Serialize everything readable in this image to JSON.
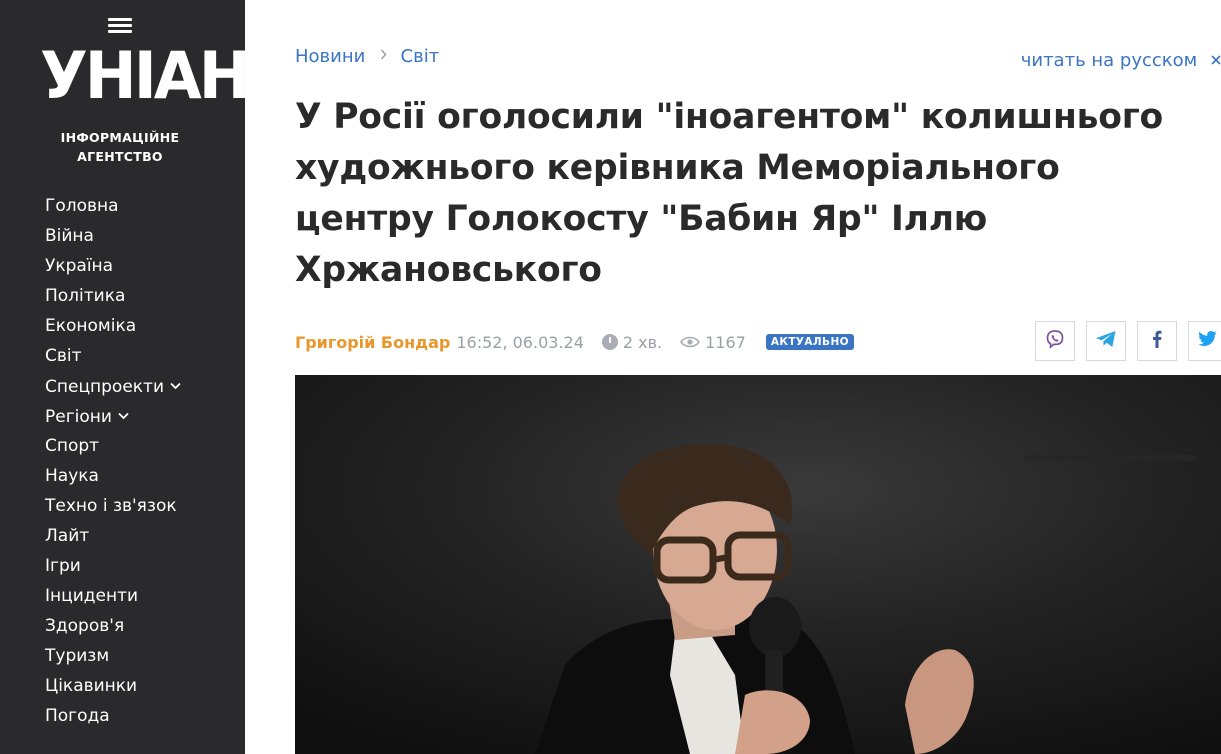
{
  "logo": {
    "name": "УНІАН",
    "subtitle_line1": "ІНФОРМАЦІЙНЕ",
    "subtitle_line2": "АГЕНТСТВО"
  },
  "nav": {
    "items": [
      {
        "label": "Головна"
      },
      {
        "label": "Війна"
      },
      {
        "label": "Україна"
      },
      {
        "label": "Політика"
      },
      {
        "label": "Економіка"
      },
      {
        "label": "Світ"
      },
      {
        "label": "Спецпроекти",
        "dropdown": true
      },
      {
        "label": "Регіони",
        "dropdown": true
      },
      {
        "label": "Спорт"
      },
      {
        "label": "Наука"
      },
      {
        "label": "Техно і зв'язок"
      },
      {
        "label": "Лайт"
      },
      {
        "label": "Ігри"
      },
      {
        "label": "Інциденти"
      },
      {
        "label": "Здоров'я"
      },
      {
        "label": "Туризм"
      },
      {
        "label": "Цікавинки"
      },
      {
        "label": "Погода"
      }
    ]
  },
  "breadcrumb": {
    "items": [
      "Новини",
      "Світ"
    ]
  },
  "lang_link": "читать на русском",
  "article": {
    "title": "У Росії оголосили \"іноагентом\" колишнього художнього керівника Меморіального центру Голокосту \"Бабин Яр\" Іллю Хржановського",
    "author": "Григорій Бондар",
    "datetime": "16:52, 06.03.24",
    "read_time": "2 хв.",
    "views": "1167",
    "badge": "АКТУАЛЬНО"
  },
  "share": {
    "buttons": [
      {
        "icon": "viber-icon",
        "color": "#7b519d"
      },
      {
        "icon": "telegram-icon",
        "color": "#2ca5e0"
      },
      {
        "icon": "facebook-icon",
        "color": "#3b5998"
      },
      {
        "icon": "twitter-icon",
        "color": "#1da1f2"
      }
    ]
  },
  "colors": {
    "sidebar_bg": "#2a2a2d",
    "link": "#3a75c4",
    "author": "#e9962b",
    "title": "#2a2a2a"
  }
}
